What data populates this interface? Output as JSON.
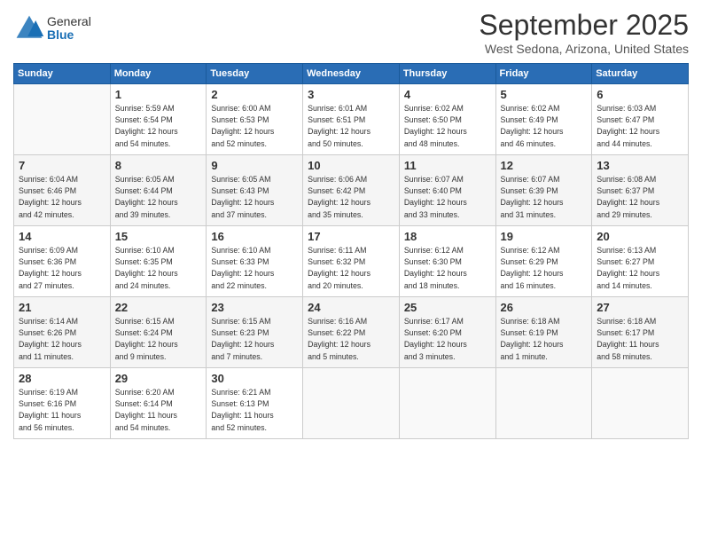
{
  "logo": {
    "general": "General",
    "blue": "Blue"
  },
  "title": "September 2025",
  "location": "West Sedona, Arizona, United States",
  "days_header": [
    "Sunday",
    "Monday",
    "Tuesday",
    "Wednesday",
    "Thursday",
    "Friday",
    "Saturday"
  ],
  "weeks": [
    [
      {
        "day": "",
        "info": ""
      },
      {
        "day": "1",
        "info": "Sunrise: 5:59 AM\nSunset: 6:54 PM\nDaylight: 12 hours\nand 54 minutes."
      },
      {
        "day": "2",
        "info": "Sunrise: 6:00 AM\nSunset: 6:53 PM\nDaylight: 12 hours\nand 52 minutes."
      },
      {
        "day": "3",
        "info": "Sunrise: 6:01 AM\nSunset: 6:51 PM\nDaylight: 12 hours\nand 50 minutes."
      },
      {
        "day": "4",
        "info": "Sunrise: 6:02 AM\nSunset: 6:50 PM\nDaylight: 12 hours\nand 48 minutes."
      },
      {
        "day": "5",
        "info": "Sunrise: 6:02 AM\nSunset: 6:49 PM\nDaylight: 12 hours\nand 46 minutes."
      },
      {
        "day": "6",
        "info": "Sunrise: 6:03 AM\nSunset: 6:47 PM\nDaylight: 12 hours\nand 44 minutes."
      }
    ],
    [
      {
        "day": "7",
        "info": "Sunrise: 6:04 AM\nSunset: 6:46 PM\nDaylight: 12 hours\nand 42 minutes."
      },
      {
        "day": "8",
        "info": "Sunrise: 6:05 AM\nSunset: 6:44 PM\nDaylight: 12 hours\nand 39 minutes."
      },
      {
        "day": "9",
        "info": "Sunrise: 6:05 AM\nSunset: 6:43 PM\nDaylight: 12 hours\nand 37 minutes."
      },
      {
        "day": "10",
        "info": "Sunrise: 6:06 AM\nSunset: 6:42 PM\nDaylight: 12 hours\nand 35 minutes."
      },
      {
        "day": "11",
        "info": "Sunrise: 6:07 AM\nSunset: 6:40 PM\nDaylight: 12 hours\nand 33 minutes."
      },
      {
        "day": "12",
        "info": "Sunrise: 6:07 AM\nSunset: 6:39 PM\nDaylight: 12 hours\nand 31 minutes."
      },
      {
        "day": "13",
        "info": "Sunrise: 6:08 AM\nSunset: 6:37 PM\nDaylight: 12 hours\nand 29 minutes."
      }
    ],
    [
      {
        "day": "14",
        "info": "Sunrise: 6:09 AM\nSunset: 6:36 PM\nDaylight: 12 hours\nand 27 minutes."
      },
      {
        "day": "15",
        "info": "Sunrise: 6:10 AM\nSunset: 6:35 PM\nDaylight: 12 hours\nand 24 minutes."
      },
      {
        "day": "16",
        "info": "Sunrise: 6:10 AM\nSunset: 6:33 PM\nDaylight: 12 hours\nand 22 minutes."
      },
      {
        "day": "17",
        "info": "Sunrise: 6:11 AM\nSunset: 6:32 PM\nDaylight: 12 hours\nand 20 minutes."
      },
      {
        "day": "18",
        "info": "Sunrise: 6:12 AM\nSunset: 6:30 PM\nDaylight: 12 hours\nand 18 minutes."
      },
      {
        "day": "19",
        "info": "Sunrise: 6:12 AM\nSunset: 6:29 PM\nDaylight: 12 hours\nand 16 minutes."
      },
      {
        "day": "20",
        "info": "Sunrise: 6:13 AM\nSunset: 6:27 PM\nDaylight: 12 hours\nand 14 minutes."
      }
    ],
    [
      {
        "day": "21",
        "info": "Sunrise: 6:14 AM\nSunset: 6:26 PM\nDaylight: 12 hours\nand 11 minutes."
      },
      {
        "day": "22",
        "info": "Sunrise: 6:15 AM\nSunset: 6:24 PM\nDaylight: 12 hours\nand 9 minutes."
      },
      {
        "day": "23",
        "info": "Sunrise: 6:15 AM\nSunset: 6:23 PM\nDaylight: 12 hours\nand 7 minutes."
      },
      {
        "day": "24",
        "info": "Sunrise: 6:16 AM\nSunset: 6:22 PM\nDaylight: 12 hours\nand 5 minutes."
      },
      {
        "day": "25",
        "info": "Sunrise: 6:17 AM\nSunset: 6:20 PM\nDaylight: 12 hours\nand 3 minutes."
      },
      {
        "day": "26",
        "info": "Sunrise: 6:18 AM\nSunset: 6:19 PM\nDaylight: 12 hours\nand 1 minute."
      },
      {
        "day": "27",
        "info": "Sunrise: 6:18 AM\nSunset: 6:17 PM\nDaylight: 11 hours\nand 58 minutes."
      }
    ],
    [
      {
        "day": "28",
        "info": "Sunrise: 6:19 AM\nSunset: 6:16 PM\nDaylight: 11 hours\nand 56 minutes."
      },
      {
        "day": "29",
        "info": "Sunrise: 6:20 AM\nSunset: 6:14 PM\nDaylight: 11 hours\nand 54 minutes."
      },
      {
        "day": "30",
        "info": "Sunrise: 6:21 AM\nSunset: 6:13 PM\nDaylight: 11 hours\nand 52 minutes."
      },
      {
        "day": "",
        "info": ""
      },
      {
        "day": "",
        "info": ""
      },
      {
        "day": "",
        "info": ""
      },
      {
        "day": "",
        "info": ""
      }
    ]
  ]
}
